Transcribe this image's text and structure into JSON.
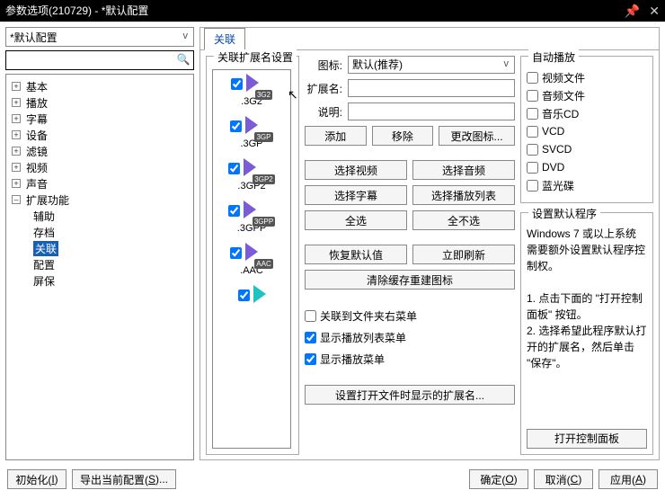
{
  "title": "参数选项(210729) - *默认配置",
  "profile_combo": "*默认配置",
  "search_value": "",
  "tree": {
    "items": [
      {
        "label": "基本",
        "exp": "+"
      },
      {
        "label": "播放",
        "exp": "+"
      },
      {
        "label": "字幕",
        "exp": "+"
      },
      {
        "label": "设备",
        "exp": "+"
      },
      {
        "label": "滤镜",
        "exp": "+"
      },
      {
        "label": "视频",
        "exp": "+"
      },
      {
        "label": "声音",
        "exp": "+"
      },
      {
        "label": "扩展功能",
        "exp": "–",
        "expanded": true,
        "children": [
          {
            "label": "辅助"
          },
          {
            "label": "存档"
          },
          {
            "label": "关联",
            "selected": true
          },
          {
            "label": "配置"
          },
          {
            "label": "屏保"
          }
        ]
      }
    ]
  },
  "tab_label": "关联",
  "ext_group_title": "关联扩展名设置",
  "ext_list": [
    {
      "name": ".3G2",
      "badge": "3G2",
      "checked": true
    },
    {
      "name": ".3GP",
      "badge": "3GP",
      "checked": true
    },
    {
      "name": ".3GP2",
      "badge": "3GP2",
      "checked": true
    },
    {
      "name": ".3GPP",
      "badge": "3GPP",
      "checked": true
    },
    {
      "name": ".AAC",
      "badge": "AAC",
      "checked": true
    },
    {
      "name": "",
      "badge": "",
      "checked": true,
      "teal": true
    }
  ],
  "fields": {
    "icon_label": "图标:",
    "icon_value": "默认(推荐)",
    "ext_label": "扩展名:",
    "ext_value": "",
    "desc_label": "说明:",
    "desc_value": ""
  },
  "buttons": {
    "add": "添加",
    "remove": "移除",
    "change_icon": "更改图标...",
    "sel_video": "选择视频",
    "sel_audio": "选择音频",
    "sel_sub": "选择字幕",
    "sel_playlist": "选择播放列表",
    "sel_all": "全选",
    "sel_none": "全不选",
    "restore": "恢复默认值",
    "refresh": "立即刷新",
    "clear_cache": "清除缓存重建图标",
    "open_ext_dialog": "设置打开文件时显示的扩展名..."
  },
  "checks": {
    "folder_menu": "关联到文件夹右菜单",
    "show_playlist_menu": "显示播放列表菜单",
    "show_play_menu": "显示播放菜单"
  },
  "autoplay": {
    "title": "自动播放",
    "items": [
      "视频文件",
      "音频文件",
      "音乐CD",
      "VCD",
      "SVCD",
      "DVD",
      "蓝光碟"
    ]
  },
  "default_prog": {
    "title": "设置默认程序",
    "body": "Windows 7 或以上系统需要额外设置默认程序控制权。\n\n1. 点击下面的 \"打开控制面板\" 按钮。\n2. 选择希望此程序默认打开的扩展名，然后单击 \"保存\"。",
    "open_cp": "打开控制面板"
  },
  "footer": {
    "init": "初始化(",
    "init_key": "I",
    "init_end": ")",
    "export": "导出当前配置(",
    "export_key": "S",
    "export_end": ")...",
    "ok": "确定(",
    "ok_key": "O",
    "ok_end": ")",
    "cancel": "取消(",
    "cancel_key": "C",
    "cancel_end": ")",
    "apply": "应用(",
    "apply_key": "A",
    "apply_end": ")"
  }
}
